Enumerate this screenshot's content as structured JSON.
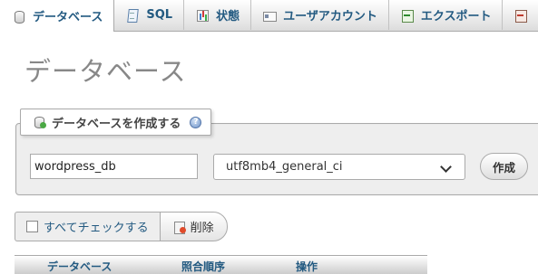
{
  "tabs": [
    {
      "label": "データベース",
      "icon": "database-icon",
      "active": true
    },
    {
      "label": "SQL",
      "icon": "sql-icon"
    },
    {
      "label": "状態",
      "icon": "status-icon"
    },
    {
      "label": "ユーザアカウント",
      "icon": "user-accounts-icon"
    },
    {
      "label": "エクスポート",
      "icon": "export-icon"
    },
    {
      "label": "",
      "icon": "import-icon"
    }
  ],
  "page_title": "データベース",
  "create": {
    "legend": "データベースを作成する",
    "name_value": "wordpress_db",
    "collation": "utf8mb4_general_ci",
    "button": "作成"
  },
  "bulk": {
    "check_all": "すべてチェックする",
    "delete": "削除"
  },
  "table": {
    "columns": [
      "データベース",
      "照合順序",
      "操作"
    ]
  }
}
